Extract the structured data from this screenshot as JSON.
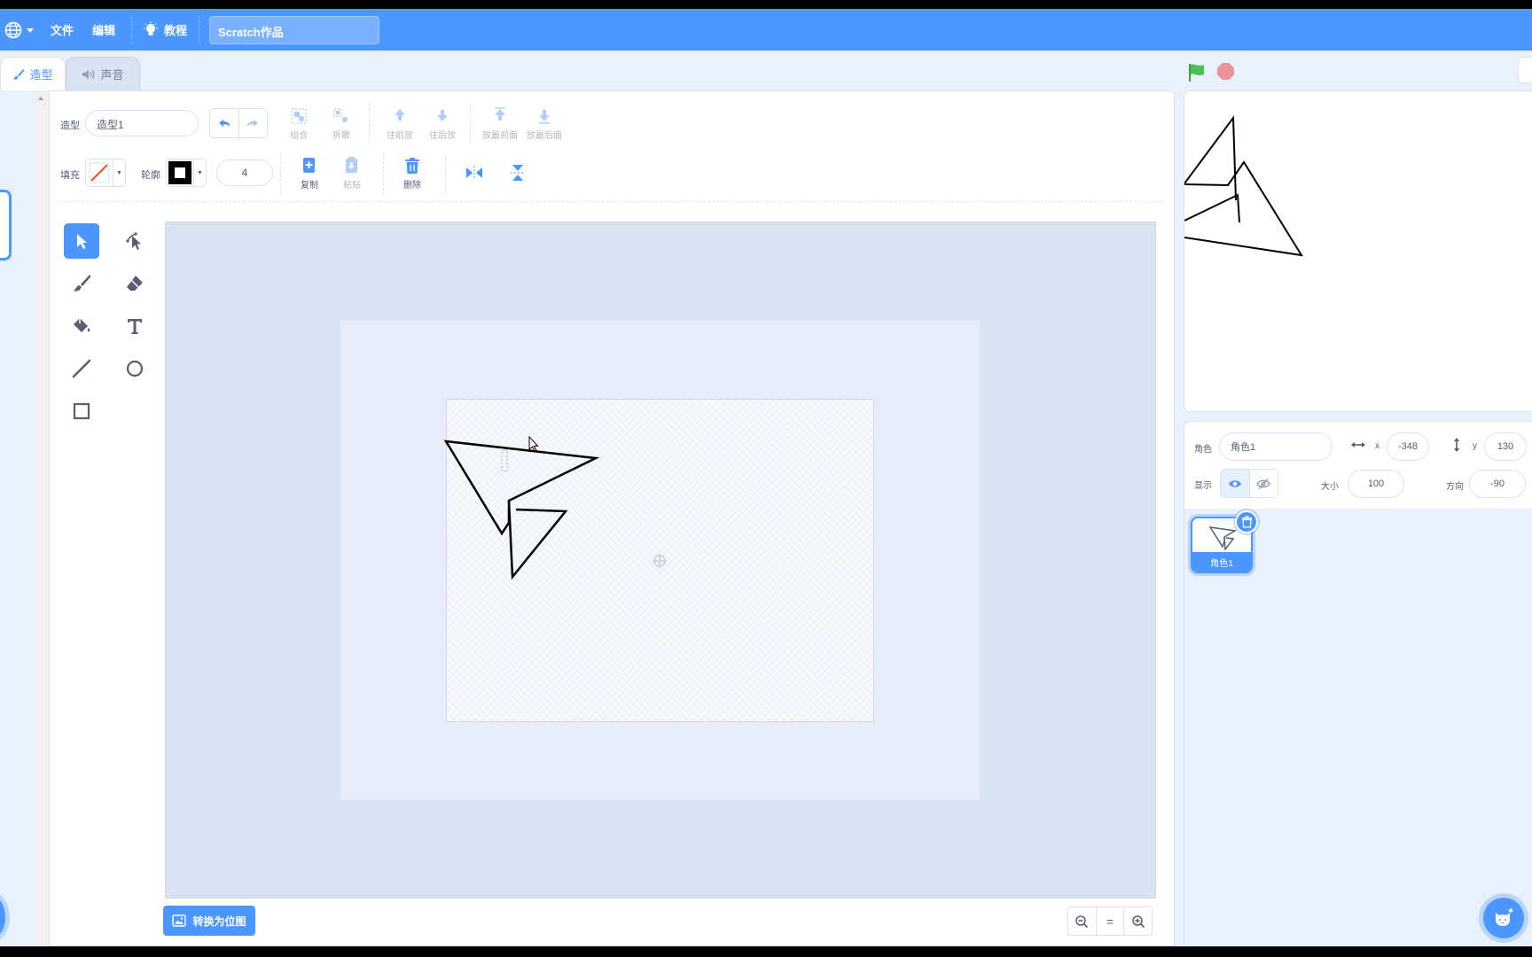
{
  "menubar": {
    "file": "文件",
    "edit": "编辑",
    "tutorials": "教程",
    "project_title": "Scratch作品"
  },
  "tabs": {
    "costumes": "造型",
    "sounds": "声音"
  },
  "paint": {
    "costume_label": "造型",
    "costume_name": "造型1",
    "group": "组合",
    "ungroup": "拆散",
    "forward": "往前放",
    "backward": "往后放",
    "front": "放最前面",
    "back": "放最后面",
    "fill_label": "填充",
    "outline_label": "轮廓",
    "outline_width": "4",
    "copy": "复制",
    "paste": "粘贴",
    "delete": "删除",
    "convert_bitmap": "转换为位图",
    "zoom_reset": "="
  },
  "sprite": {
    "sprite_label": "角色",
    "sprite_name": "角色1",
    "x_label": "x",
    "x_value": "-348",
    "y_label": "y",
    "y_value": "130",
    "show_label": "显示",
    "size_label": "大小",
    "size_value": "100",
    "direction_label": "方向",
    "direction_value": "-90",
    "tile_name": "角色1"
  },
  "colors": {
    "accent": "#4c97ff",
    "menubar": "#4c97ff",
    "background": "#e9f1fc",
    "text": "#575e75",
    "stop": "#ec5959",
    "flag": "#4cbf56"
  }
}
